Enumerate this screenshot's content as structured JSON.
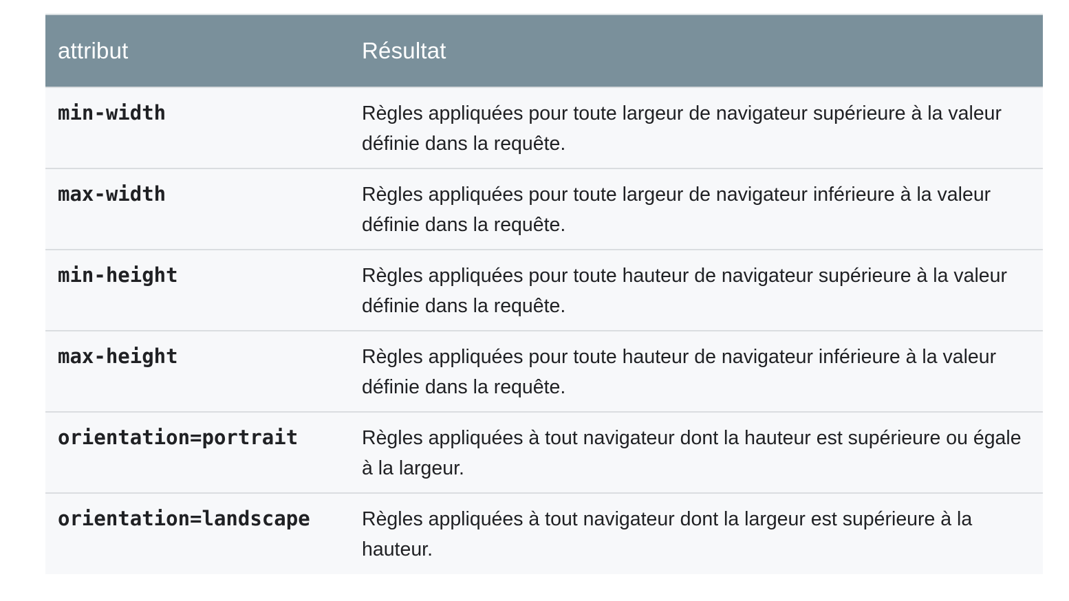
{
  "table": {
    "headers": {
      "attribute": "attribut",
      "result": "Résultat"
    },
    "rows": [
      {
        "attribute": "min-width",
        "result": "Règles appliquées pour toute largeur de navigateur supérieure à la valeur définie dans la requête."
      },
      {
        "attribute": "max-width",
        "result": "Règles appliquées pour toute largeur de navigateur inférieure à la valeur définie dans la requête."
      },
      {
        "attribute": "min-height",
        "result": "Règles appliquées pour toute hauteur de navigateur supérieure à la valeur définie dans la requête."
      },
      {
        "attribute": "max-height",
        "result": "Règles appliquées pour toute hauteur de navigateur inférieure à la valeur définie dans la requête."
      },
      {
        "attribute": "orientation=portrait",
        "result": "Règles appliquées à tout navigateur dont la hauteur est supérieure ou égale à la largeur."
      },
      {
        "attribute": "orientation=landscape",
        "result": "Règles appliquées à tout navigateur dont la largeur est supérieure à la hauteur."
      }
    ]
  },
  "colors": {
    "header_background": "#7a909b",
    "header_text": "#ffffff",
    "row_background": "#f7f8fa",
    "row_divider": "#dadde0",
    "body_text": "#202124"
  }
}
